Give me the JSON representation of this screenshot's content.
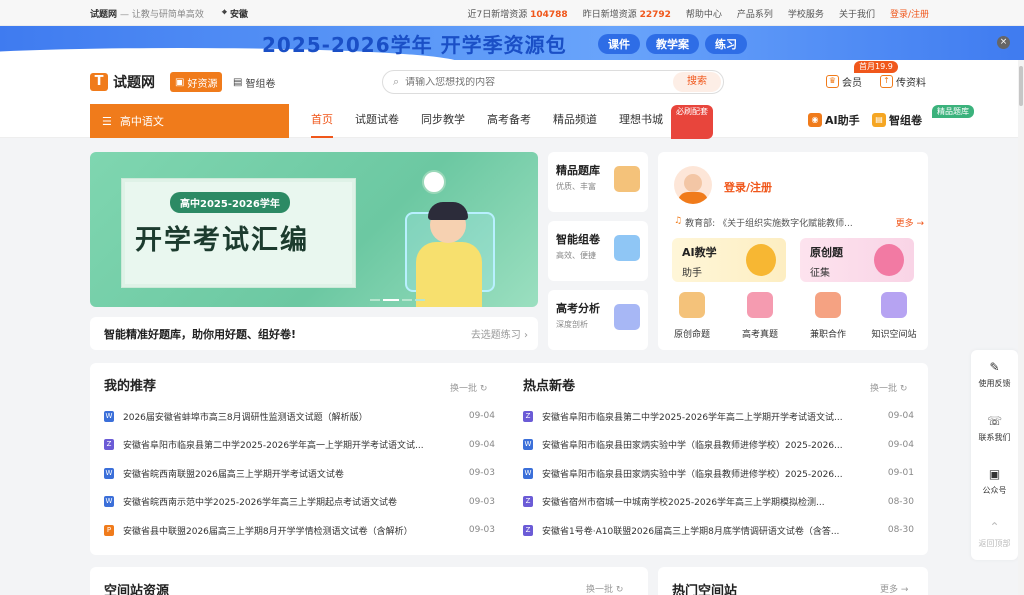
{
  "topbar": {
    "brand": "试题网",
    "slogan": "— 让教与研简单高效",
    "location": "安徽",
    "week_label": "近7日新增资源",
    "week_count": "104788",
    "yesterday_label": "昨日新增资源",
    "yesterday_count": "22792",
    "links": [
      "帮助中心",
      "产品系列",
      "学校服务",
      "关于我们"
    ],
    "login": "登录/注册"
  },
  "banner": {
    "title": "2025-2026学年 开学季资源包",
    "pills": [
      "课件",
      "教学案",
      "练习"
    ],
    "close": "×"
  },
  "header": {
    "logo": "试题网",
    "tab_resource": "好资源",
    "tab_compose": "智组卷",
    "search_placeholder": "请输入您想找的内容",
    "search_button": "搜索",
    "vip": "会员",
    "vip_badge": "首月19.9",
    "upload": "传资料"
  },
  "nav": {
    "subject": "高中语文",
    "items": [
      "首页",
      "试题试卷",
      "同步教学",
      "高考备考",
      "精品频道",
      "理想书城"
    ],
    "book_badge": "必刷配套",
    "ai": "AI助手",
    "compose": "智组卷",
    "compose_badge": "精品题库"
  },
  "hero": {
    "pill": "高中2025-2026学年",
    "title": "开学考试汇编",
    "strip_text": "智能精准好题库，助你用好题、组好卷!",
    "strip_link": "去选题练习"
  },
  "side": [
    {
      "title": "精品题库",
      "sub": "优质、丰富"
    },
    {
      "title": "智能组卷",
      "sub": "高效、便捷"
    },
    {
      "title": "高考分析",
      "sub": "深度剖析"
    }
  ],
  "user": {
    "login": "登录/注册",
    "news_source": "教育部:",
    "news_text": "《关于组织实施数字化赋能教师...",
    "news_more": "更多 →",
    "feat1_title": "AI教学",
    "feat1_sub": "助手",
    "feat2_title": "原创题",
    "feat2_sub": "征集",
    "icons": [
      "原创命题",
      "高考真题",
      "兼职合作",
      "知识空间站"
    ]
  },
  "recommend": {
    "title": "我的推荐",
    "refresh": "换一批",
    "rows": [
      {
        "text": "2026届安徽省蚌埠市高三8月调研性监测语文试题（解析版）",
        "date": "09-04",
        "type": "word"
      },
      {
        "text": "安徽省阜阳市临泉县第二中学2025-2026学年高一上学期开学考试语文试...",
        "date": "09-04",
        "type": "zip"
      },
      {
        "text": "安徽省皖西南联盟2026届高三上学期开学考试语文试卷",
        "date": "09-03",
        "type": "word"
      },
      {
        "text": "安徽省皖西南示范中学2025-2026学年高三上学期起点考试语文试卷",
        "date": "09-03",
        "type": "word"
      },
      {
        "text": "安徽省县中联盟2026届高三上学期8月开学学情检测语文试卷（含解析）",
        "date": "09-03",
        "type": "pdf"
      }
    ]
  },
  "hot": {
    "title": "热点新卷",
    "refresh": "换一批",
    "rows": [
      {
        "text": "安徽省阜阳市临泉县第二中学2025-2026学年高二上学期开学考试语文试...",
        "date": "09-04",
        "type": "zip"
      },
      {
        "text": "安徽省阜阳市临泉县田家炳实验中学（临泉县教师进修学校）2025-2026...",
        "date": "09-04",
        "type": "word"
      },
      {
        "text": "安徽省阜阳市临泉县田家炳实验中学（临泉县教师进修学校）2025-2026...",
        "date": "09-01",
        "type": "word"
      },
      {
        "text": "安徽省宿州市宿城一中城南学校2025-2026学年高三上学期模拟检测...",
        "date": "08-30",
        "type": "zip"
      },
      {
        "text": "安徽省1号卷·A10联盟2026届高三上学期8月底学情调研语文试卷（含答...",
        "date": "08-30",
        "type": "zip"
      }
    ]
  },
  "bottom": {
    "space_title": "空间站资源",
    "space_refresh": "换一批",
    "hot_title": "热门空间站",
    "hot_more": "更多 →"
  },
  "floatbar": [
    "使用反馈",
    "联系我们",
    "公众号",
    "返回顶部"
  ]
}
